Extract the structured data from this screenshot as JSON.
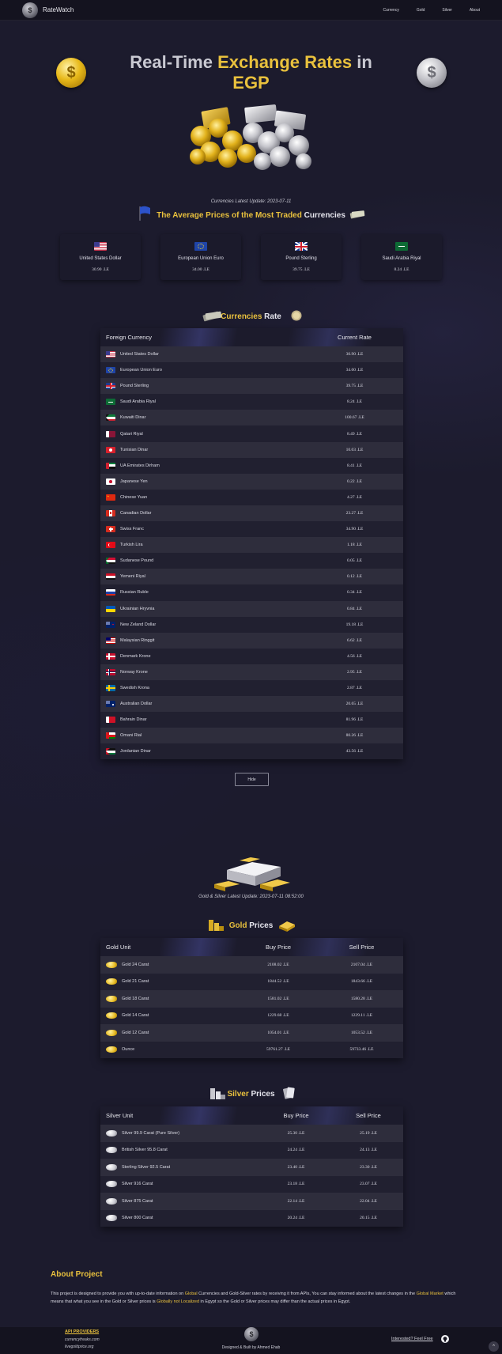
{
  "nav": {
    "brand": "RateWatch",
    "links": [
      "Currency",
      "Gold",
      "Silver",
      "About"
    ]
  },
  "hero": {
    "title_part1": "Real-Time",
    "title_part2": "Exchange Rates",
    "title_part3": "in",
    "title_part4": "EGP"
  },
  "currencies_update": "Currencies Latest Update: 2023-07-11",
  "avg_heading": {
    "part1": "The Average Prices of the Most Traded",
    "part2": "Currencies"
  },
  "avg_cards": [
    {
      "name": "United States Dollar",
      "value": "30.90 .LE",
      "flag": "us"
    },
    {
      "name": "European Union Euro",
      "value": "34.00 .LE",
      "flag": "eu"
    },
    {
      "name": "Pound Sterling",
      "value": "39.75 .LE",
      "flag": "gb"
    },
    {
      "name": "Saudi Arabia Riyal",
      "value": "8.24 .LE",
      "flag": "sa"
    }
  ],
  "rate_heading": {
    "part1": "Currencies",
    "part2": "Rate"
  },
  "currency_table": {
    "headers": [
      "Foreign Currency",
      "Current Rate"
    ],
    "rows": [
      {
        "name": "United States Dollar",
        "rate": "30.90 .LE",
        "flag": "us"
      },
      {
        "name": "European Union Euro",
        "rate": "34.00 .LE",
        "flag": "eu"
      },
      {
        "name": "Pound Sterling",
        "rate": "39.75 .LE",
        "flag": "gb"
      },
      {
        "name": "Saudi Arabia Riyal",
        "rate": "8.24 .LE",
        "flag": "sa"
      },
      {
        "name": "Kuwaiti Dinar",
        "rate": "100.67 .LE",
        "flag": "kw"
      },
      {
        "name": "Qatari Riyal",
        "rate": "8.49 .LE",
        "flag": "qa"
      },
      {
        "name": "Tunisian Dinar",
        "rate": "10.03 .LE",
        "flag": "tn"
      },
      {
        "name": "UA Emirates Dirham",
        "rate": "8.41 .LE",
        "flag": "ae"
      },
      {
        "name": "Japanese Yen",
        "rate": "0.22 .LE",
        "flag": "jp"
      },
      {
        "name": "Chinese Yuan",
        "rate": "4.27 .LE",
        "flag": "cn"
      },
      {
        "name": "Canadian Dollar",
        "rate": "23.27 .LE",
        "flag": "ca"
      },
      {
        "name": "Swiss Franc",
        "rate": "34.90 .LE",
        "flag": "ch"
      },
      {
        "name": "Turkish Lira",
        "rate": "1.18 .LE",
        "flag": "tr"
      },
      {
        "name": "Sudanese Pound",
        "rate": "0.05 .LE",
        "flag": "sd"
      },
      {
        "name": "Yemeni Riyal",
        "rate": "0.12 .LE",
        "flag": "ye"
      },
      {
        "name": "Russian Ruble",
        "rate": "0.34 .LE",
        "flag": "ru"
      },
      {
        "name": "Ukrainian Hryvnia",
        "rate": "0.84 .LE",
        "flag": "ua"
      },
      {
        "name": "New Zeland Dollar",
        "rate": "19.18 .LE",
        "flag": "nz"
      },
      {
        "name": "Malaysian Ringgit",
        "rate": "6.62 .LE",
        "flag": "my"
      },
      {
        "name": "Denmark Krone",
        "rate": "4.56 .LE",
        "flag": "dk"
      },
      {
        "name": "Norway Krone",
        "rate": "2.95 .LE",
        "flag": "no"
      },
      {
        "name": "Swedish Krona",
        "rate": "2.87 .LE",
        "flag": "se"
      },
      {
        "name": "Australian Dollar",
        "rate": "20.65 .LE",
        "flag": "au"
      },
      {
        "name": "Bahrain Dinar",
        "rate": "81.96 .LE",
        "flag": "bh"
      },
      {
        "name": "Omani Rial",
        "rate": "80.26 .LE",
        "flag": "om"
      },
      {
        "name": "Jordanian Dinar",
        "rate": "43.56 .LE",
        "flag": "jo"
      }
    ]
  },
  "hide_button": "Hide",
  "metal_update": "Gold & Silver Latest Update: 2023-07-11 08:52:00",
  "gold_heading": {
    "part1": "Gold",
    "part2": "Prices"
  },
  "gold_table": {
    "headers": [
      "Gold Unit",
      "Buy Price",
      "Sell Price"
    ],
    "rows": [
      {
        "unit": "Gold 24 Carat",
        "buy": "2108.02 .LE",
        "sell": "2107.04 .LE"
      },
      {
        "unit": "Gold 21 Carat",
        "buy": "1844.52 .LE",
        "sell": "1843.66 .LE"
      },
      {
        "unit": "Gold 18 Carat",
        "buy": "1581.02 .LE",
        "sell": "1580.28 .LE"
      },
      {
        "unit": "Gold 14 Carat",
        "buy": "1229.68 .LE",
        "sell": "1229.11 .LE"
      },
      {
        "unit": "Gold 12 Carat",
        "buy": "1054.01 .LE",
        "sell": "1053.52 .LE"
      },
      {
        "unit": "Ounce",
        "buy": "59761.27 .LE",
        "sell": "59733.46 .LE"
      }
    ]
  },
  "silver_heading": {
    "part1": "Silver",
    "part2": "Prices"
  },
  "silver_table": {
    "headers": [
      "Silver Unit",
      "Buy Price",
      "Sell Price"
    ],
    "rows": [
      {
        "unit": "Silver 99.9 Carat (Pure Silver)",
        "buy": "25.30 .LE",
        "sell": "25.19 .LE"
      },
      {
        "unit": "British Silver 95.8 Carat",
        "buy": "24.24 .LE",
        "sell": "24.13 .LE"
      },
      {
        "unit": "Sterling Silver 92.5 Carat",
        "buy": "23.40 .LE",
        "sell": "23.30 .LE"
      },
      {
        "unit": "Silver 916 Carat",
        "buy": "23.18 .LE",
        "sell": "23.07 .LE"
      },
      {
        "unit": "Silver 875 Carat",
        "buy": "22.14 .LE",
        "sell": "22.04 .LE"
      },
      {
        "unit": "Silver 800 Carat",
        "buy": "20.24 .LE",
        "sell": "20.15 .LE"
      }
    ]
  },
  "about": {
    "title": "About Project",
    "t1": "This project is designed to provide you with up-to-date information on ",
    "h1": "Global",
    "t2": " Currencies and Gold-Silver rates by receiving it from APIs, You can stay informed about the latest changes in the ",
    "h2": "Global Market",
    "t3": " which means that what you see in the Gold or Silver prices is ",
    "h3": "Globally not Localized",
    "t4": " in Egypt so the Gold or Silver prices may differ than the actual prices in Egypt."
  },
  "footer": {
    "providers_title": "API PROVIDERS",
    "provider1": "currencyfreaks.com",
    "provider2": "livegoldprice.org",
    "credit": "Designed & Built by Ahmed Ehab",
    "feel_free": "Interested? Feel Free"
  },
  "colors": {
    "accent_gold": "#e9c13d",
    "background": "#1c1b2d",
    "nav": "#14131f"
  }
}
